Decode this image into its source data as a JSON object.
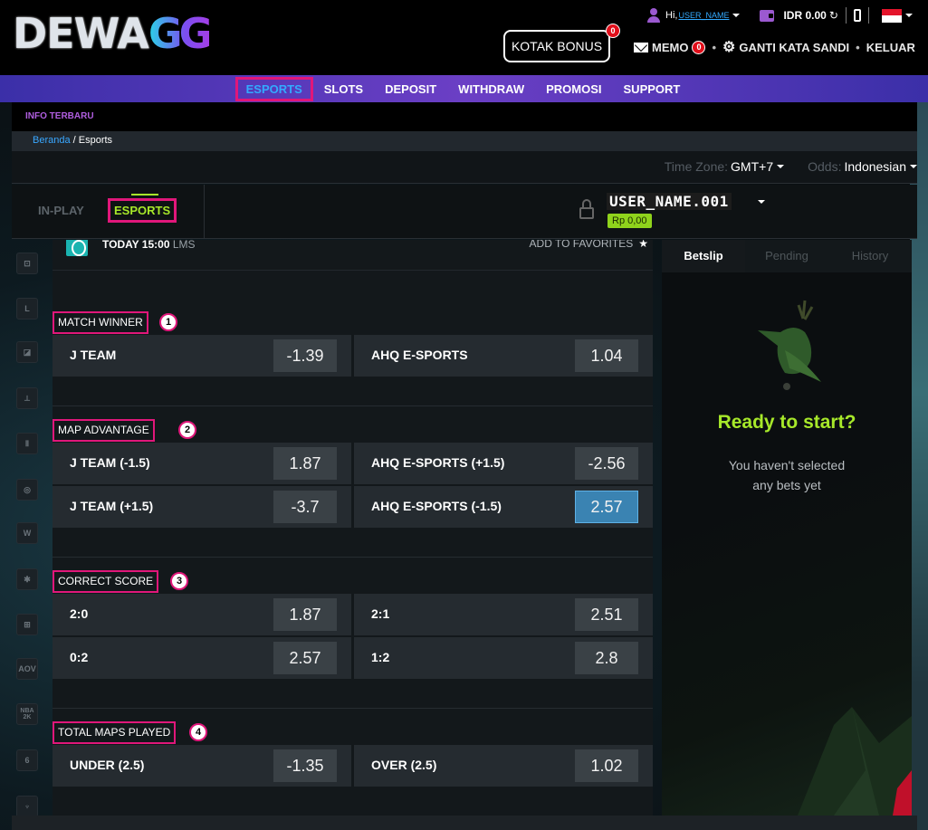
{
  "brand": {
    "logo_part1": "DEWA",
    "logo_part2": "GG"
  },
  "topbar": {
    "greeting": "Hi,",
    "username": "USER_NAME",
    "balance": "IDR 0.00",
    "refresh_glyph": "↻",
    "flag": "indonesia"
  },
  "header": {
    "bonus_label": "KOTAK BONUS",
    "bonus_count": "0",
    "memo_label": "MEMO",
    "memo_count": "0",
    "password_label": "GANTI KATA SANDI",
    "logout_label": "KELUAR",
    "separator": "•"
  },
  "nav": {
    "items": [
      {
        "label": "ESPORTS"
      },
      {
        "label": "SLOTS"
      },
      {
        "label": "DEPOSIT"
      },
      {
        "label": "WITHDRAW"
      },
      {
        "label": "PROMOSI"
      },
      {
        "label": "SUPPORT"
      }
    ]
  },
  "info": {
    "label": "INFO TERBARU"
  },
  "breadcrumb": {
    "home": "Beranda",
    "sep": " / ",
    "current": "Esports"
  },
  "settings": {
    "timezone_label": "Time Zone:",
    "timezone_value": "GMT+7",
    "odds_label": "Odds:",
    "odds_value": "Indonesian"
  },
  "tabs": {
    "inplay": "IN-PLAY",
    "esports": "ESPORTS"
  },
  "account": {
    "name": "USER_NAME.001",
    "balance": "Rp 0,00"
  },
  "sidebar": {
    "games": [
      "gamepad",
      "league-of-legends",
      "dota2",
      "csgo",
      "heroes",
      "overwatch",
      "warcraft",
      "starcraft",
      "crossfire",
      "AOV",
      "NBA 2K",
      "rainbow-six",
      "magic"
    ]
  },
  "match": {
    "time": "TODAY 15:00",
    "league": "LMS",
    "favorites_label": "ADD TO FAVORITES",
    "star": "★",
    "sections": [
      {
        "number": "1",
        "title": "MATCH WINNER",
        "rows": [
          [
            {
              "team": "J TEAM",
              "odd": "-1.39"
            },
            {
              "team": "AHQ E-SPORTS",
              "odd": "1.04"
            }
          ]
        ]
      },
      {
        "number": "2",
        "title": "MAP ADVANTAGE",
        "rows": [
          [
            {
              "team": "J TEAM (-1.5)",
              "odd": "1.87"
            },
            {
              "team": "AHQ E-SPORTS (+1.5)",
              "odd": "-2.56"
            }
          ],
          [
            {
              "team": "J TEAM (+1.5)",
              "odd": "-3.7"
            },
            {
              "team": "AHQ E-SPORTS (-1.5)",
              "odd": "2.57",
              "selected": true
            }
          ]
        ]
      },
      {
        "number": "3",
        "title": "CORRECT SCORE",
        "rows": [
          [
            {
              "team": "2:0",
              "odd": "1.87"
            },
            {
              "team": "2:1",
              "odd": "2.51"
            }
          ],
          [
            {
              "team": "0:2",
              "odd": "2.57"
            },
            {
              "team": "1:2",
              "odd": "2.8"
            }
          ]
        ]
      },
      {
        "number": "4",
        "title": "TOTAL MAPS PLAYED",
        "rows": [
          [
            {
              "team": "UNDER (2.5)",
              "odd": "-1.35"
            },
            {
              "team": "OVER (2.5)",
              "odd": "1.02"
            }
          ]
        ]
      }
    ]
  },
  "betslip": {
    "tabs": [
      "Betslip",
      "Pending",
      "History"
    ],
    "title": "Ready to start?",
    "line1": "You haven't selected",
    "line2": "any bets yet"
  },
  "colors": {
    "accent_green": "#a7e82a",
    "highlight_pink": "#e0177a",
    "link_blue": "#33aaff",
    "nav_purple": "#6b3fc5",
    "selected_odd": "#3a83b2"
  }
}
